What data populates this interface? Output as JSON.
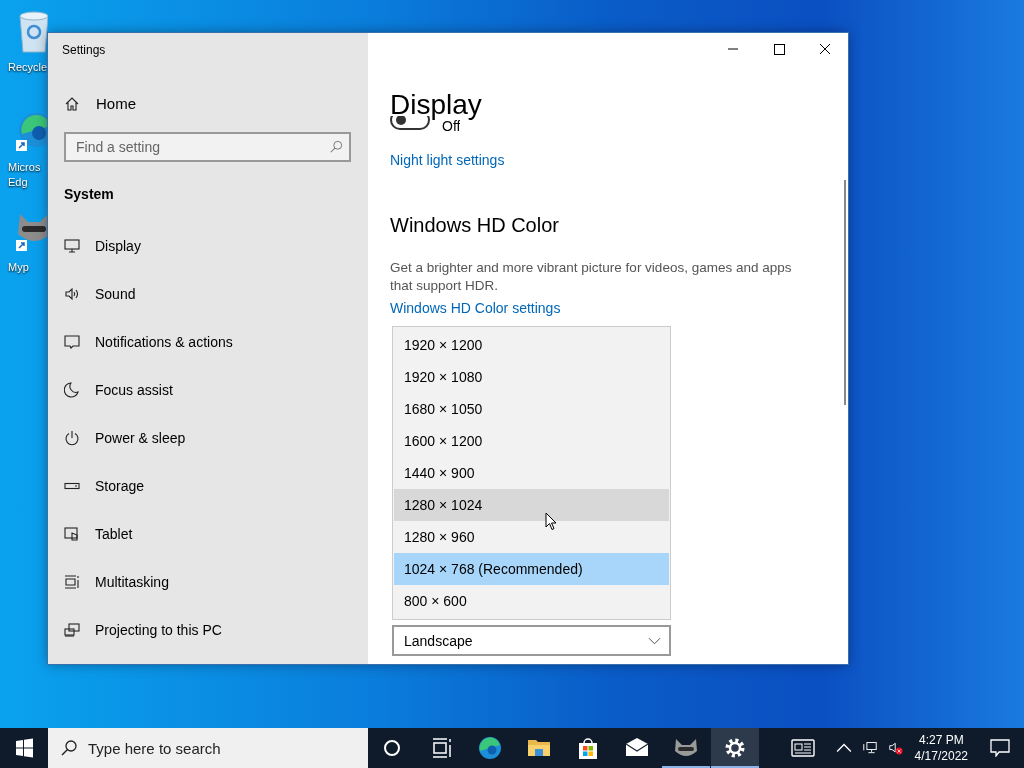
{
  "desktop_icons": [
    {
      "kind": "recycle-bin",
      "lines": [
        "Recycle"
      ]
    },
    {
      "kind": "browser",
      "lines": [
        "Micros",
        "Edg"
      ]
    },
    {
      "kind": "raccoon",
      "lines": [
        "Myp"
      ]
    }
  ],
  "window": {
    "title": "Settings"
  },
  "sidebar": {
    "home": "Home",
    "search": {
      "placeholder": "Find a setting"
    },
    "section": "System",
    "items": [
      {
        "kind": "display",
        "label": "Display"
      },
      {
        "kind": "sound",
        "label": "Sound"
      },
      {
        "kind": "notifications",
        "label": "Notifications & actions"
      },
      {
        "kind": "focus",
        "label": "Focus assist"
      },
      {
        "kind": "power",
        "label": "Power & sleep"
      },
      {
        "kind": "storage",
        "label": "Storage"
      },
      {
        "kind": "tablet",
        "label": "Tablet"
      },
      {
        "kind": "multitasking",
        "label": "Multitasking"
      },
      {
        "kind": "projecting",
        "label": "Projecting to this PC"
      }
    ]
  },
  "content": {
    "heading": "Display",
    "toggle": {
      "on": false,
      "label": "Off"
    },
    "night_light_link": "Night light settings",
    "hd_color": {
      "heading": "Windows HD Color",
      "description": "Get a brighter and more vibrant picture for videos, games and apps that support HDR.",
      "link": "Windows HD Color settings"
    },
    "resolution_list": {
      "options": [
        {
          "label": "1920 × 1200",
          "selected": false,
          "hovered": false
        },
        {
          "label": "1920 × 1080",
          "selected": false,
          "hovered": false
        },
        {
          "label": "1680 × 1050",
          "selected": false,
          "hovered": false
        },
        {
          "label": "1600 × 1200",
          "selected": false,
          "hovered": false
        },
        {
          "label": "1440 × 900",
          "selected": false,
          "hovered": false
        },
        {
          "label": "1280 × 1024",
          "selected": false,
          "hovered": true
        },
        {
          "label": "1280 × 960",
          "selected": false,
          "hovered": false
        },
        {
          "label": "1024 × 768 (Recommended)",
          "selected": true,
          "hovered": false
        },
        {
          "label": "800 × 600",
          "selected": false,
          "hovered": false
        }
      ]
    },
    "orientation": {
      "value": "Landscape"
    }
  },
  "taskbar": {
    "search": {
      "placeholder": "Type here to search"
    },
    "apps": [
      {
        "kind": "cortana",
        "open": false,
        "active": false
      },
      {
        "kind": "task-view",
        "open": false,
        "active": false
      },
      {
        "kind": "edge",
        "open": false,
        "active": false
      },
      {
        "kind": "explorer",
        "open": false,
        "active": false
      },
      {
        "kind": "store",
        "open": false,
        "active": false
      },
      {
        "kind": "mail",
        "open": false,
        "active": false
      },
      {
        "kind": "raccoon",
        "open": true,
        "active": false
      },
      {
        "kind": "settings",
        "open": true,
        "active": true
      }
    ],
    "time": "4:27 PM",
    "date": "4/17/2022"
  }
}
